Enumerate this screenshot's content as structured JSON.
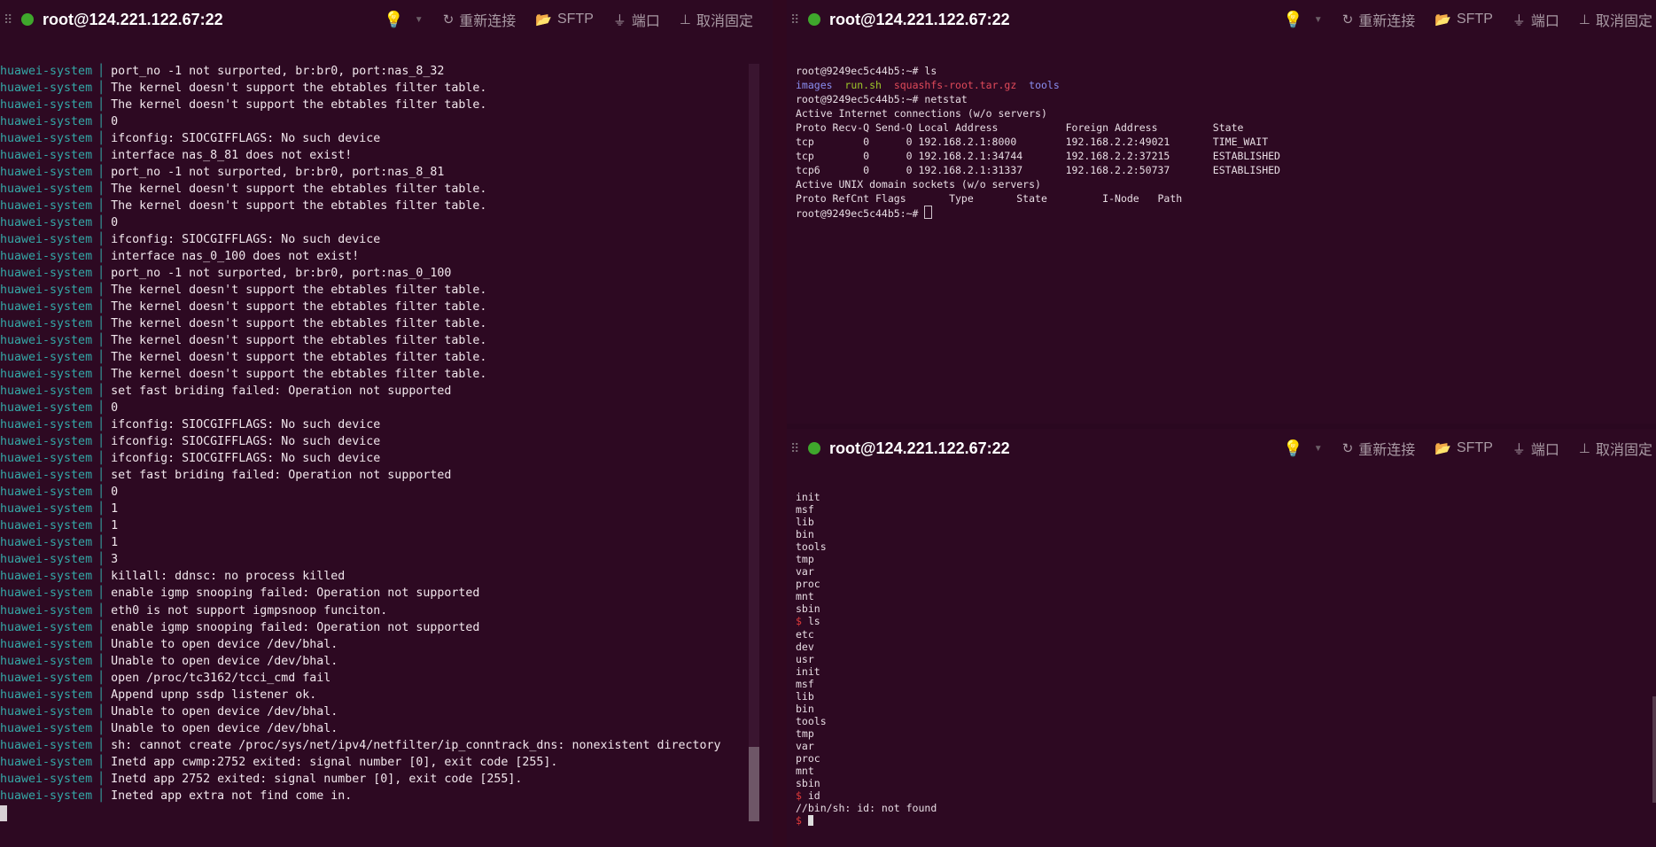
{
  "colors": {
    "background": "#2d0922",
    "source_text": "#34a8a7",
    "status_online": "#3fa72c",
    "prompt_dollar": "#e03a3a"
  },
  "panes": {
    "left": {
      "title": "root@124.221.122.67:22",
      "toolbar": {
        "reconnect": "重新连接",
        "sftp": "SFTP",
        "port": "端口",
        "unpin": "取消固定"
      },
      "icons": {
        "bulb": "lightbulb-icon",
        "reconnect": "refresh-icon",
        "sftp": "folder-icon",
        "port": "plug-icon",
        "unpin": "pin-icon"
      },
      "log_source": "huawei-system",
      "log": [
        "port_no -1 not surported, br:br0, port:nas_8_32",
        "The kernel doesn't support the ebtables filter table.",
        "The kernel doesn't support the ebtables filter table.",
        "0",
        "ifconfig: SIOCGIFFLAGS: No such device",
        "interface nas_8_81 does not exist!",
        "port_no -1 not surported, br:br0, port:nas_8_81",
        "The kernel doesn't support the ebtables filter table.",
        "The kernel doesn't support the ebtables filter table.",
        "0",
        "ifconfig: SIOCGIFFLAGS: No such device",
        "interface nas_0_100 does not exist!",
        "port_no -1 not surported, br:br0, port:nas_0_100",
        "The kernel doesn't support the ebtables filter table.",
        "The kernel doesn't support the ebtables filter table.",
        "The kernel doesn't support the ebtables filter table.",
        "The kernel doesn't support the ebtables filter table.",
        "The kernel doesn't support the ebtables filter table.",
        "The kernel doesn't support the ebtables filter table.",
        "set fast briding failed: Operation not supported",
        "0",
        "ifconfig: SIOCGIFFLAGS: No such device",
        "ifconfig: SIOCGIFFLAGS: No such device",
        "ifconfig: SIOCGIFFLAGS: No such device",
        "set fast briding failed: Operation not supported",
        "0",
        "1",
        "1",
        "1",
        "3",
        "killall: ddnsc: no process killed",
        "enable igmp snooping failed: Operation not supported",
        "eth0 is not support igmpsnoop funciton.",
        "enable igmp snooping failed: Operation not supported",
        "Unable to open device /dev/bhal.",
        "Unable to open device /dev/bhal.",
        "open /proc/tc3162/tcci_cmd fail",
        "Append upnp ssdp listener ok.",
        "Unable to open device /dev/bhal.",
        "Unable to open device /dev/bhal.",
        "sh: cannot create /proc/sys/net/ipv4/netfilter/ip_conntrack_dns: nonexistent directory",
        "Inetd app cwmp:2752 exited: signal number [0], exit code [255].",
        "Inetd app 2752 exited: signal number [0], exit code [255].",
        "Ineted app extra not find come in."
      ]
    },
    "top_right": {
      "title": "root@124.221.122.67:22",
      "toolbar": {
        "reconnect": "重新连接",
        "sftp": "SFTP",
        "port": "端口",
        "unpin": "取消固定"
      },
      "prompt1": "root@9249ec5c44b5:~# ls",
      "ls": {
        "images": "images",
        "run": "run.sh",
        "archive": "squashfs-root.tar.gz",
        "tools": "tools"
      },
      "prompt2": "root@9249ec5c44b5:~# netstat",
      "lines": [
        "Active Internet connections (w/o servers)",
        "Proto Recv-Q Send-Q Local Address           Foreign Address         State",
        "tcp        0      0 192.168.2.1:8000        192.168.2.2:49021       TIME_WAIT",
        "tcp        0      0 192.168.2.1:34744       192.168.2.2:37215       ESTABLISHED",
        "tcp6       0      0 192.168.2.1:31337       192.168.2.2:50737       ESTABLISHED",
        "Active UNIX domain sockets (w/o servers)",
        "Proto RefCnt Flags       Type       State         I-Node   Path"
      ],
      "prompt3": "root@9249ec5c44b5:~# "
    },
    "bottom_right": {
      "title": "root@124.221.122.67:22",
      "toolbar": {
        "reconnect": "重新连接",
        "sftp": "SFTP",
        "port": "端口",
        "unpin": "取消固定"
      },
      "list1": [
        "init",
        "msf",
        "lib",
        "bin",
        "tools",
        "tmp",
        "var",
        "proc",
        "mnt",
        "sbin"
      ],
      "cmd_ls": "ls",
      "list2": [
        "etc",
        "dev",
        "usr",
        "init",
        "msf",
        "lib",
        "bin",
        "tools",
        "tmp",
        "var",
        "proc",
        "mnt",
        "sbin"
      ],
      "cmd_id": "id",
      "id_error": "//bin/sh: id: not found",
      "dollar": "$"
    }
  }
}
